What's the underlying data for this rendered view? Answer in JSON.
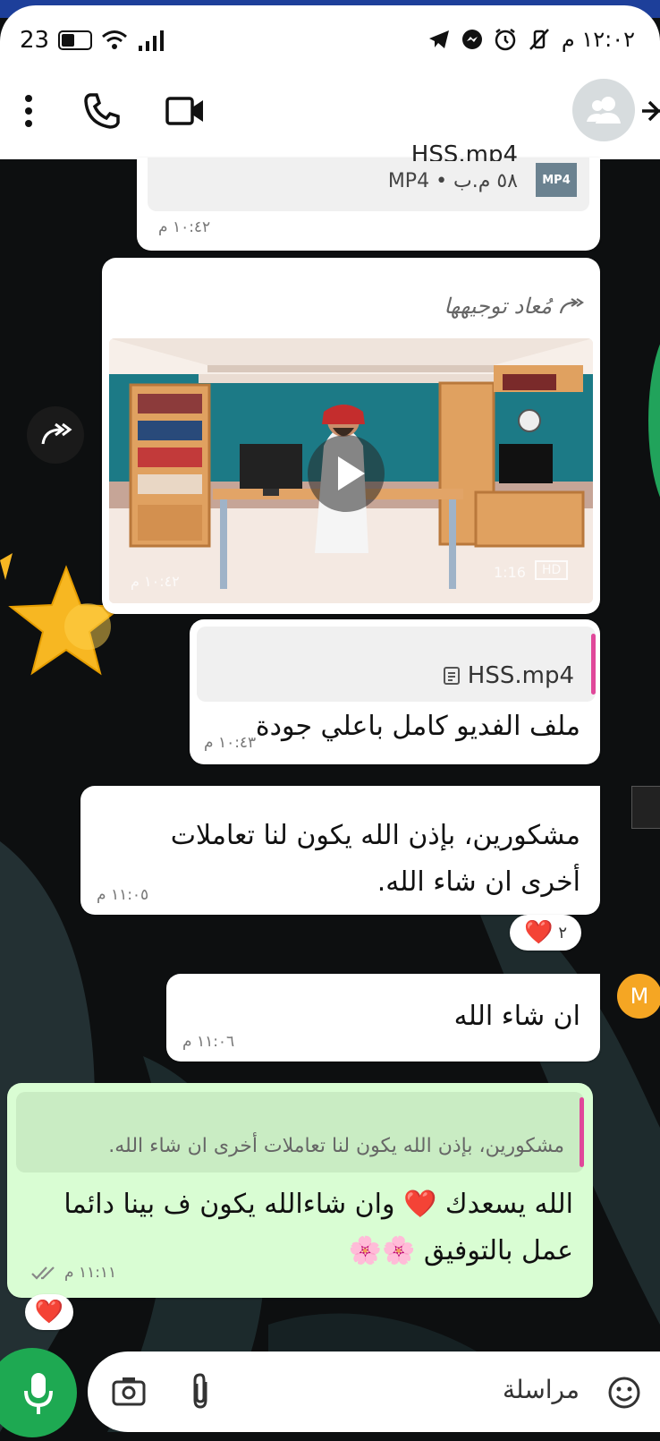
{
  "status_bar": {
    "time": "١٢:٠٢ م",
    "battery": "23"
  },
  "chat": {
    "avatar_alt": "contact avatar"
  },
  "messages": {
    "file1": {
      "name": "HSS.mp4",
      "meta": "٥٨ م.ب • MP4",
      "badge": "MP4",
      "time": "١٠:٤٢ م"
    },
    "video": {
      "forwarded_label": "مُعاد توجيهها",
      "duration": "1:16",
      "time": "١٠:٤٢ م",
      "hd": "HD"
    },
    "file2": {
      "name": "HSS.mp4",
      "caption": "ملف الفديو كامل باعلي جودة",
      "time": "١٠:٤٣ م"
    },
    "m1": {
      "text": "مشكورين، بإذن الله يكون لنا تعاملات أخرى ان شاء الله.",
      "time": "١١:٠٥ م",
      "reaction_count": "٢"
    },
    "m2": {
      "text": "ان شاء الله",
      "time": "١١:٠٦ م",
      "sender_initial": "M"
    },
    "m3": {
      "quote": "مشكورين، بإذن الله يكون لنا تعاملات أخرى ان شاء الله.",
      "text": "الله يسعدك ❤️ وان شاءالله يكون ف بينا دائما عمل بالتوفيق 🌸🌸",
      "time": "١١:١١ م"
    }
  },
  "composer": {
    "placeholder": "مراسلة"
  },
  "colors": {
    "accent": "#1ea952",
    "outgoing": "#d9fdd3",
    "highlight": "#e0489a"
  }
}
